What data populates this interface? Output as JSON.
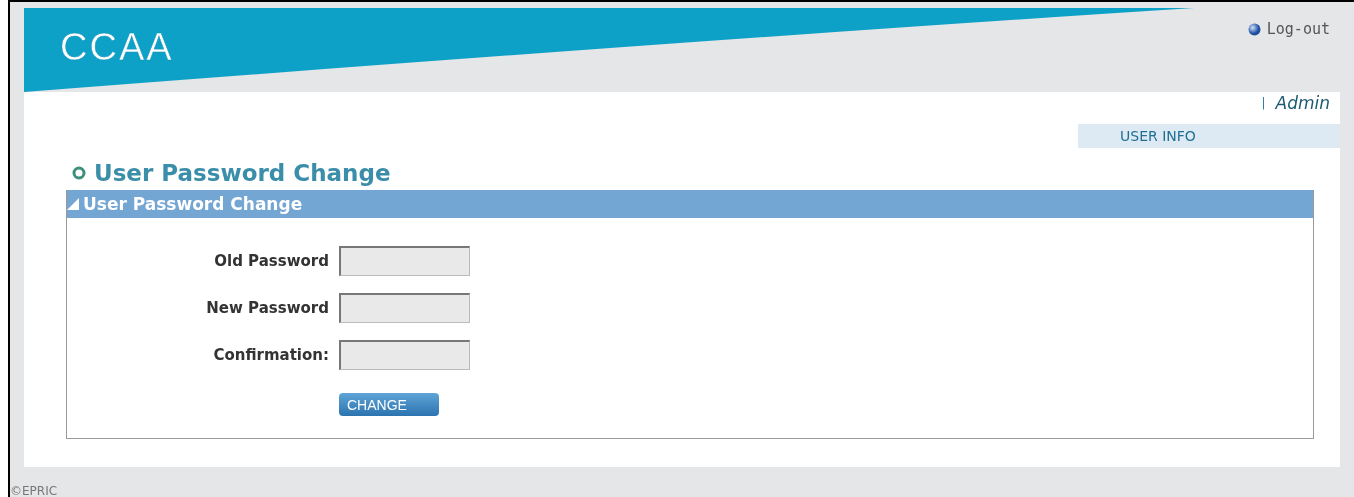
{
  "header": {
    "logo": "CCAA",
    "logout": "Log-out",
    "separator": "|",
    "user": "Admin",
    "menu": "USER INFO"
  },
  "page_title": "User Password Change",
  "panel": {
    "title": "User Password Change",
    "fields": [
      {
        "label": "Old Password"
      },
      {
        "label": "New Password"
      },
      {
        "label": "Confirmation:"
      }
    ],
    "button": "CHANGE"
  },
  "footer": "©EPRIC"
}
